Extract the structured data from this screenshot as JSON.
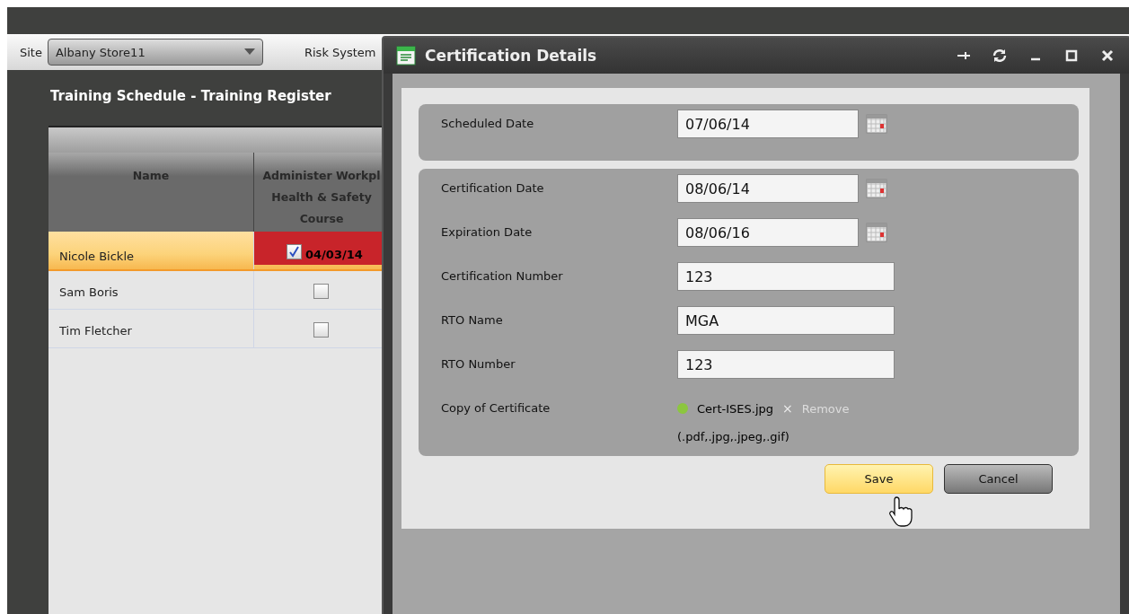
{
  "toolbar": {
    "site_label": "Site",
    "site_value": "Albany Store11",
    "risk_label": "Risk System"
  },
  "page_title": "Training Schedule - Training Register",
  "table": {
    "columns": [
      "Name",
      "Administer Workpl\nHealth & Safety\nCourse"
    ],
    "rows": [
      {
        "name": "Nicole Bickle",
        "selected": true,
        "checked": true,
        "date": "04/03/14"
      },
      {
        "name": "Sam Boris",
        "selected": false,
        "checked": false
      },
      {
        "name": "Tim Fletcher",
        "selected": false,
        "checked": false
      }
    ]
  },
  "dialog": {
    "title": "Certification Details",
    "sections": [
      [
        {
          "label": "Scheduled Date",
          "value": "07/06/14",
          "kind": "date"
        }
      ],
      [
        {
          "label": "Certification Date",
          "value": "08/06/14",
          "kind": "date"
        },
        {
          "label": "Expiration Date",
          "value": "08/06/16",
          "kind": "date"
        },
        {
          "label": "Certification Number",
          "value": "123",
          "kind": "text"
        },
        {
          "label": "RTO Name",
          "value": "MGA",
          "kind": "text"
        },
        {
          "label": "RTO Number",
          "value": "123",
          "kind": "text"
        },
        {
          "label": "Copy of Certificate",
          "kind": "file",
          "file_name": "Cert-ISES.jpg",
          "remove": "×",
          "remove_label": "Remove",
          "color": "#8cc63f",
          "hint": "(.pdf,.jpg,.jpeg,.gif)"
        }
      ]
    ],
    "buttons": [
      {
        "label": "Save",
        "kind": "primary"
      },
      {
        "label": "Cancel",
        "kind": "secondary"
      }
    ]
  }
}
